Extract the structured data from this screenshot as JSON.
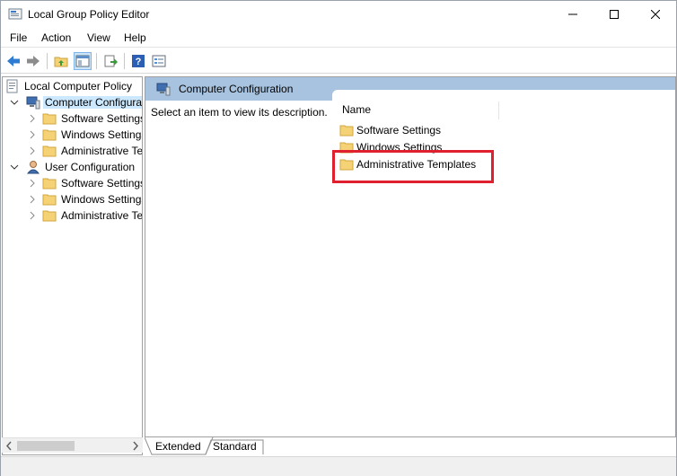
{
  "window": {
    "title": "Local Group Policy Editor",
    "controls": {
      "minimize": "minimize",
      "maximize": "maximize",
      "close": "close"
    }
  },
  "menu": [
    "File",
    "Action",
    "View",
    "Help"
  ],
  "toolbar": {
    "buttons": [
      "back-arrow-icon",
      "forward-arrow-icon",
      "up-folder-icon",
      "show-hide-tree-icon",
      "export-list-icon",
      "help-icon",
      "properties-view-icon"
    ]
  },
  "tree": {
    "root": "Local Computer Policy",
    "computer_config": "Computer Configura",
    "computer_children": [
      "Software Settings",
      "Windows Settings",
      "Administrative Te"
    ],
    "user_config": "User Configuration",
    "user_children": [
      "Software Settings",
      "Windows Settings",
      "Administrative Te"
    ]
  },
  "right_pane": {
    "header": "Computer Configuration",
    "description": "Select an item to view its description.",
    "column_name": "Name",
    "items": [
      "Software Settings",
      "Windows Settings",
      "Administrative Templates"
    ]
  },
  "tabs": {
    "extended": "Extended",
    "standard": "Standard"
  },
  "colors": {
    "header_bg": "#a7c3e0",
    "highlight": "#e0202e",
    "folder": "#f6d277"
  }
}
